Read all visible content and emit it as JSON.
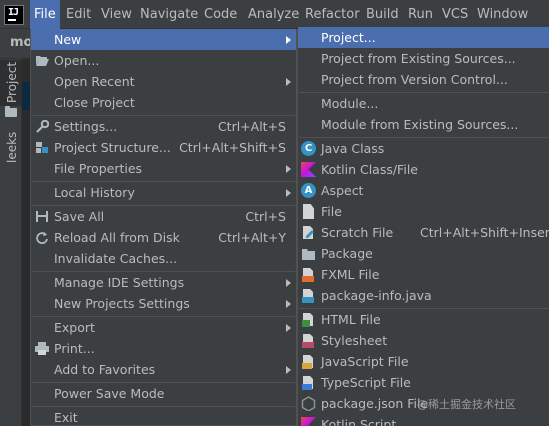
{
  "menubar": {
    "items": [
      "File",
      "Edit",
      "View",
      "Navigate",
      "Code",
      "Analyze",
      "Refactor",
      "Build",
      "Run",
      "VCS",
      "Window"
    ],
    "active": "File"
  },
  "side": {
    "breadcrumb": "mo",
    "project_tab": "Project",
    "leeks_tab": "leeks"
  },
  "file_menu": {
    "items": [
      {
        "label": "New",
        "shortcut": "",
        "submenu": true
      },
      {
        "label": "Open...",
        "shortcut": "",
        "submenu": false
      },
      {
        "label": "Open Recent",
        "shortcut": "",
        "submenu": true
      },
      {
        "label": "Close Project",
        "shortcut": "",
        "submenu": false
      },
      {
        "label": "Settings...",
        "shortcut": "Ctrl+Alt+S",
        "submenu": false
      },
      {
        "label": "Project Structure...",
        "shortcut": "Ctrl+Alt+Shift+S",
        "submenu": false
      },
      {
        "label": "File Properties",
        "shortcut": "",
        "submenu": true
      },
      {
        "label": "Local History",
        "shortcut": "",
        "submenu": true
      },
      {
        "label": "Save All",
        "shortcut": "Ctrl+S",
        "submenu": false
      },
      {
        "label": "Reload All from Disk",
        "shortcut": "Ctrl+Alt+Y",
        "submenu": false
      },
      {
        "label": "Invalidate Caches...",
        "shortcut": "",
        "submenu": false
      },
      {
        "label": "Manage IDE Settings",
        "shortcut": "",
        "submenu": true
      },
      {
        "label": "New Projects Settings",
        "shortcut": "",
        "submenu": true
      },
      {
        "label": "Export",
        "shortcut": "",
        "submenu": true
      },
      {
        "label": "Print...",
        "shortcut": "",
        "submenu": false
      },
      {
        "label": "Add to Favorites",
        "shortcut": "",
        "submenu": true
      },
      {
        "label": "Power Save Mode",
        "shortcut": "",
        "submenu": false
      },
      {
        "label": "Exit",
        "shortcut": "",
        "submenu": false
      }
    ]
  },
  "new_menu": {
    "items": [
      {
        "label": "Project...",
        "shortcut": ""
      },
      {
        "label": "Project from Existing Sources...",
        "shortcut": ""
      },
      {
        "label": "Project from Version Control...",
        "shortcut": ""
      },
      {
        "label": "Module...",
        "shortcut": ""
      },
      {
        "label": "Module from Existing Sources...",
        "shortcut": ""
      },
      {
        "label": "Java Class",
        "shortcut": ""
      },
      {
        "label": "Kotlin Class/File",
        "shortcut": ""
      },
      {
        "label": "Aspect",
        "shortcut": ""
      },
      {
        "label": "File",
        "shortcut": ""
      },
      {
        "label": "Scratch File",
        "shortcut": "Ctrl+Alt+Shift+Insert"
      },
      {
        "label": "Package",
        "shortcut": ""
      },
      {
        "label": "FXML File",
        "shortcut": ""
      },
      {
        "label": "package-info.java",
        "shortcut": ""
      },
      {
        "label": "HTML File",
        "shortcut": ""
      },
      {
        "label": "Stylesheet",
        "shortcut": ""
      },
      {
        "label": "JavaScript File",
        "shortcut": ""
      },
      {
        "label": "TypeScript File",
        "shortcut": ""
      },
      {
        "label": "package.json File",
        "shortcut": ""
      },
      {
        "label": "Kotlin Script",
        "shortcut": ""
      }
    ]
  },
  "watermark": "@稀土掘金技术社区",
  "colors": {
    "menu_bg": "#3c3f41",
    "selection": "#4b6eaf",
    "text": "#bbbbbb",
    "separator": "#515151"
  }
}
